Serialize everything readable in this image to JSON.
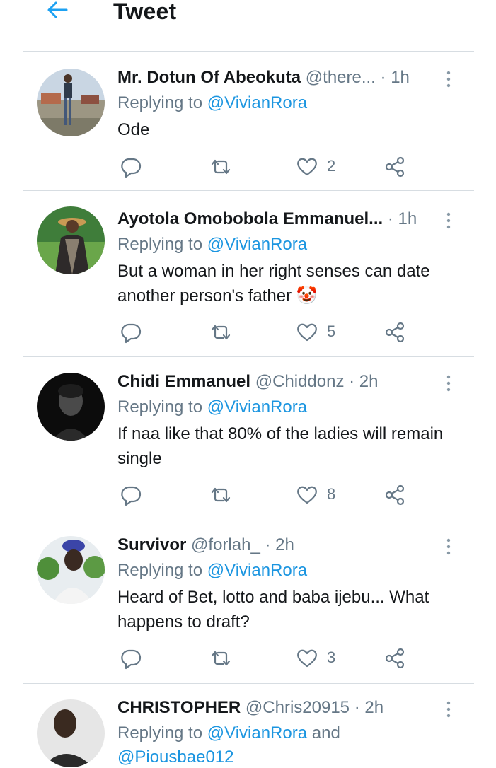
{
  "header": {
    "title": "Tweet"
  },
  "tweets": [
    {
      "name": "Mr. Dotun Of Abeokuta",
      "handle": "@there...",
      "time": "· 1h",
      "replying_prefix": "Replying to ",
      "replying_to": "@VivianRora",
      "text": "Ode",
      "likes": "2"
    },
    {
      "name": "Ayotola Omobobola Emmanuel...",
      "handle": "",
      "time": "· 1h",
      "replying_prefix": "Replying to ",
      "replying_to": "@VivianRora",
      "text": "But a woman in her right senses can date another person's father 🤡",
      "likes": "5"
    },
    {
      "name": "Chidi Emmanuel",
      "handle": "@Chiddonz",
      "time": "· 2h",
      "replying_prefix": "Replying to ",
      "replying_to": "@VivianRora",
      "text": "If naa like that 80% of the ladies will remain single",
      "likes": "8"
    },
    {
      "name": "Survivor",
      "handle": "@forlah_",
      "time": "· 2h",
      "replying_prefix": "Replying to ",
      "replying_to": "@VivianRora",
      "text": "Heard of Bet, lotto and baba ijebu... What happens to draft?",
      "likes": "3"
    },
    {
      "name": "CHRISTOPHER",
      "handle": "@Chris20915",
      "time": "· 2h",
      "replying_prefix": "Replying to ",
      "replying_to": "@VivianRora",
      "replying_joiner": " and",
      "replying_to_2": "@Piousbae012"
    }
  ]
}
